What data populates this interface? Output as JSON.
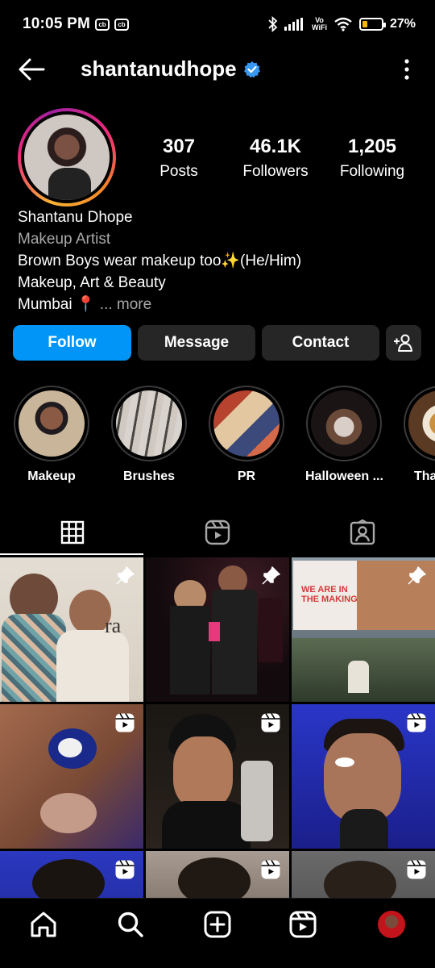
{
  "status_bar": {
    "time": "10:05 PM",
    "badge1": "cb",
    "badge2": "cb",
    "network_label_top": "Vo",
    "network_label_bottom": "WiFi",
    "battery": "27%",
    "battery_level": 0.27,
    "battery_color": "#f5b700"
  },
  "header": {
    "username": "shantanudhope",
    "verified": true,
    "accent": "#3897f0"
  },
  "profile": {
    "stats": [
      {
        "value": "307",
        "label": "Posts"
      },
      {
        "value": "46.1K",
        "label": "Followers"
      },
      {
        "value": "1,205",
        "label": "Following"
      }
    ],
    "name": "Shantanu Dhope",
    "category": "Makeup Artist",
    "bio_line1": "Brown Boys wear makeup too✨(He/Him)",
    "bio_line2": "Makeup, Art & Beauty",
    "bio_line3": "Mumbai 📍",
    "more_label": "... more"
  },
  "actions": {
    "follow": "Follow",
    "message": "Message",
    "contact": "Contact",
    "follow_color": "#0095f6"
  },
  "highlights": [
    {
      "label": "Makeup"
    },
    {
      "label": "Brushes"
    },
    {
      "label": "PR"
    },
    {
      "label": "Halloween ..."
    },
    {
      "label": "Tha"
    }
  ],
  "tabs": [
    {
      "icon": "grid-icon",
      "selected": true
    },
    {
      "icon": "reels-icon",
      "selected": false
    },
    {
      "icon": "tagged-icon",
      "selected": false
    }
  ],
  "grid": {
    "cell_texts": {
      "billboard_text": "WE ARE IN THE MAKING",
      "backdrop_text": "ra"
    },
    "badges": [
      "pin-icon",
      "pin-icon",
      "pin-icon",
      "reel-icon",
      "reel-icon",
      "reel-icon",
      "reel-icon",
      "reel-icon",
      "reel-icon"
    ]
  },
  "bottom_nav": [
    "home-icon",
    "search-icon",
    "create-icon",
    "reels-icon",
    "profile-avatar"
  ]
}
